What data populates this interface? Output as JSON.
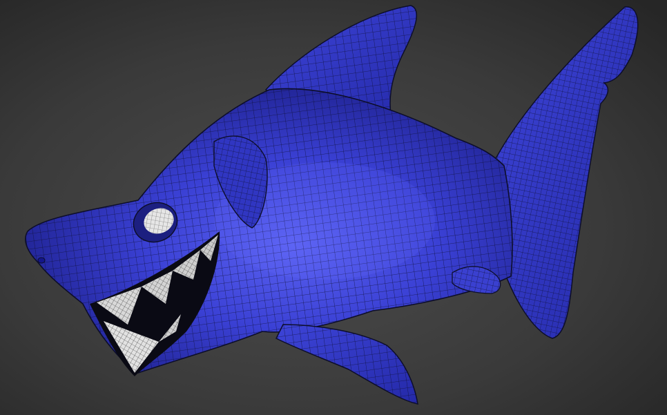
{
  "viewport": {
    "subject": "cartoon-shark-wireframe-model",
    "colors": {
      "background_top": "#2b2b2b",
      "background_mid": "#4a4a4a",
      "background_bottom": "#3c3c3c",
      "body": "#3a3fd2",
      "body_highlight": "#5a60f0",
      "body_shadow": "#1d1f8a",
      "wire": "#0d0e2a",
      "teeth": "#d9d9d9",
      "teeth_wire": "#202020",
      "eye": "#e6e6e6",
      "mouth_dark": "#0a0a14"
    }
  }
}
